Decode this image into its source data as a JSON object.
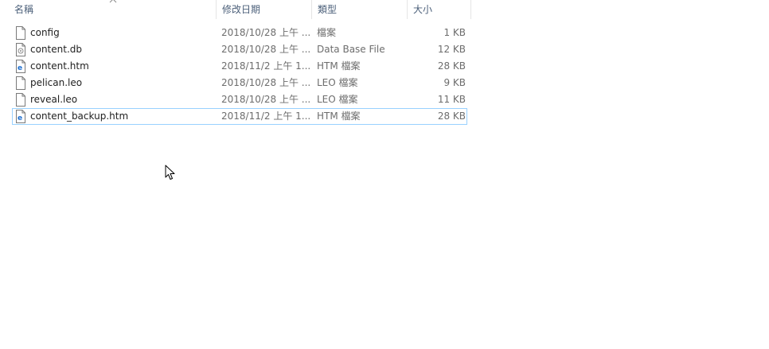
{
  "header": {
    "name_label": "名稱",
    "date_label": "修改日期",
    "type_label": "類型",
    "size_label": "大小"
  },
  "files": [
    {
      "name": "config",
      "date": "2018/10/28 上午 ...",
      "type": "檔案",
      "size": "1 KB",
      "icon": "generic-file-icon"
    },
    {
      "name": "content.db",
      "date": "2018/10/28 上午 ...",
      "type": "Data Base File",
      "size": "12 KB",
      "icon": "database-file-icon"
    },
    {
      "name": "content.htm",
      "date": "2018/11/2 上午 1...",
      "type": "HTM 檔案",
      "size": "28 KB",
      "icon": "html-file-icon"
    },
    {
      "name": "pelican.leo",
      "date": "2018/10/28 上午 ...",
      "type": "LEO 檔案",
      "size": "9 KB",
      "icon": "generic-file-icon"
    },
    {
      "name": "reveal.leo",
      "date": "2018/10/28 上午 ...",
      "type": "LEO 檔案",
      "size": "11 KB",
      "icon": "generic-file-icon"
    },
    {
      "name": "content_backup.htm",
      "date": "2018/11/2 上午 1...",
      "type": "HTM 檔案",
      "size": "28 KB",
      "icon": "html-file-icon"
    }
  ],
  "colors": {
    "header_text": "#4c607a",
    "focus_border": "#99d1ff",
    "html_icon": "#1e6fd0"
  }
}
